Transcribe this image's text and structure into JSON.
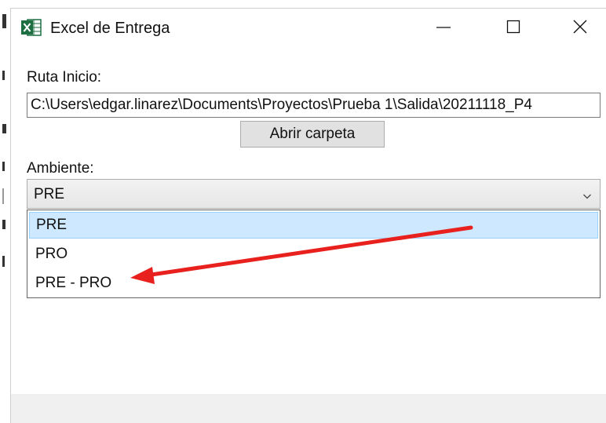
{
  "window": {
    "title": "Excel de Entrega",
    "icon": "excel-icon",
    "controls": [
      "minimize-icon",
      "maximize-icon",
      "close-icon"
    ]
  },
  "form": {
    "ruta_label": "Ruta Inicio:",
    "ruta_value": "C:\\Users\\edgar.linarez\\Documents\\Proyectos\\Prueba 1\\Salida\\20211118_P4",
    "open_button": "Abrir carpeta",
    "ambiente_label": "Ambiente:",
    "ambiente_selected": "PRE",
    "ambiente_options": [
      "PRE",
      "PRO",
      "PRE - PRO"
    ]
  },
  "colors": {
    "excel_green": "#1d6f42",
    "selection_bg": "#cde8ff",
    "annotation_arrow": "#e8201e"
  }
}
